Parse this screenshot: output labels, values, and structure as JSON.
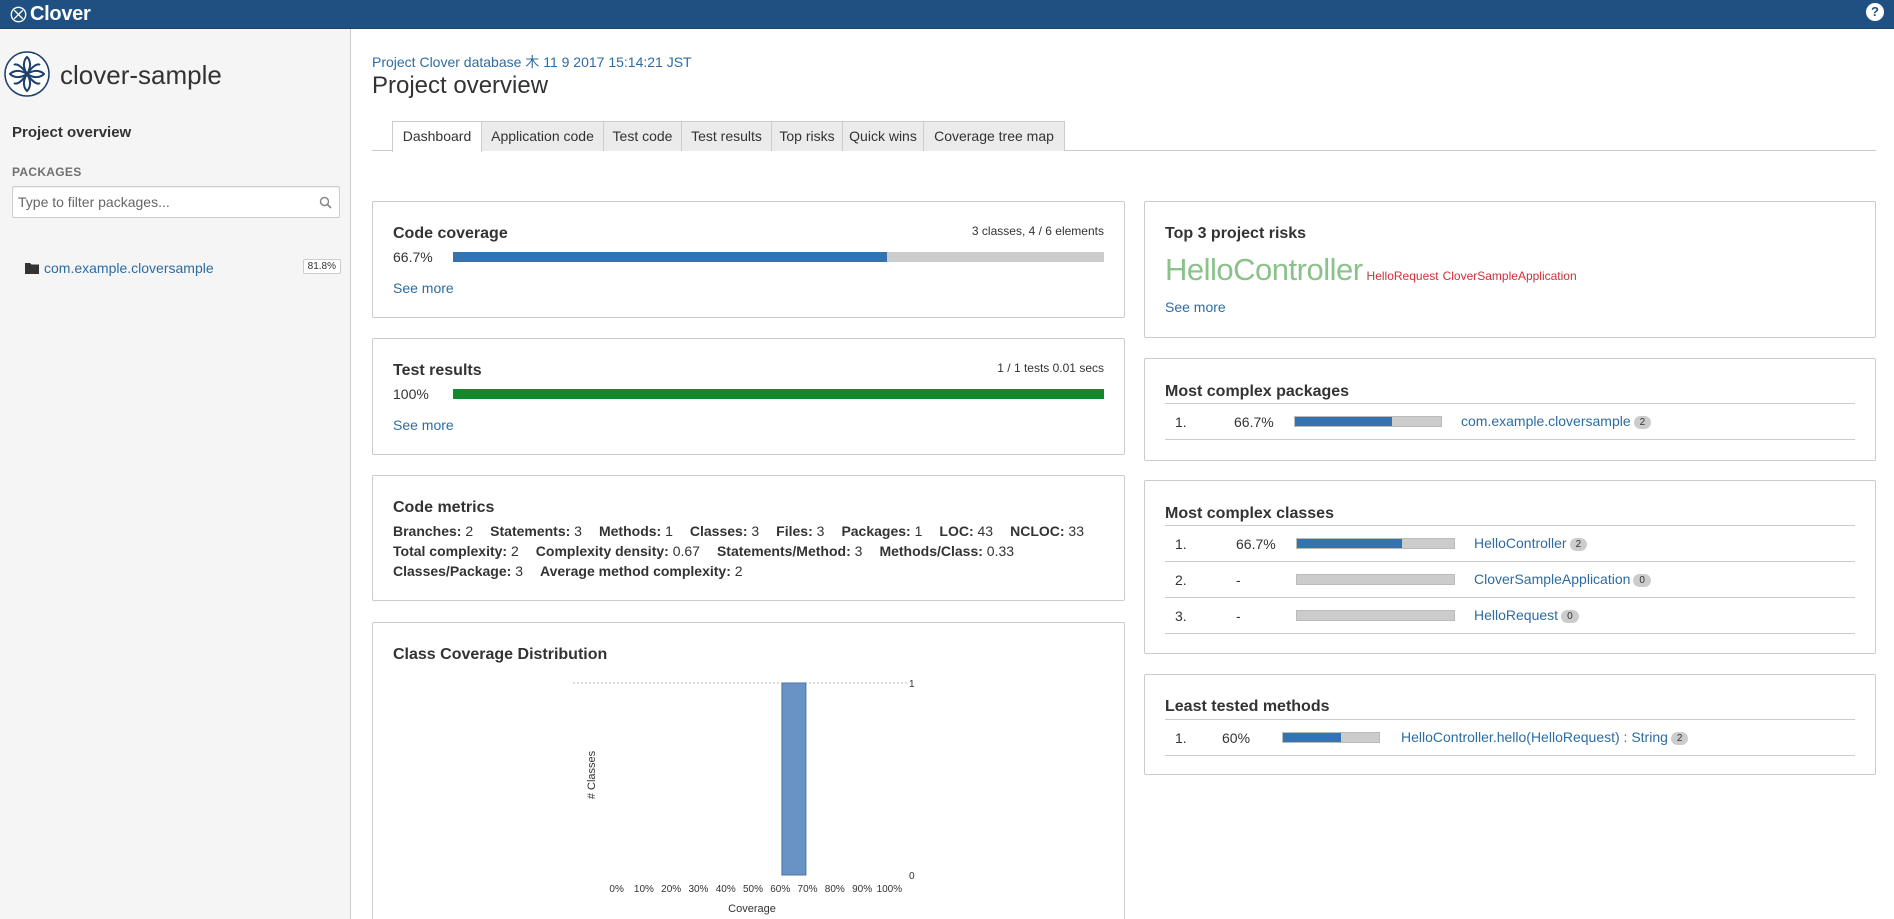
{
  "app": {
    "brand": "Clover",
    "help_glyph": "?"
  },
  "sidebar": {
    "project_name": "clover-sample",
    "nav_overview": "Project overview",
    "packages_header": "PACKAGES",
    "filter_placeholder": "Type to filter packages...",
    "packages": [
      {
        "name": "com.example.cloversample",
        "coverage": "81.8%"
      }
    ]
  },
  "header": {
    "database_line": "Project Clover database 木 11 9 2017 15:14:21 JST",
    "title": "Project overview"
  },
  "tabs": [
    {
      "label": "Dashboard",
      "active": true
    },
    {
      "label": "Application code"
    },
    {
      "label": "Test code"
    },
    {
      "label": "Test results"
    },
    {
      "label": "Top risks"
    },
    {
      "label": "Quick wins"
    },
    {
      "label": "Coverage tree map"
    }
  ],
  "code_coverage": {
    "title": "Code coverage",
    "summary": "3 classes, 4 / 6 elements",
    "percent_label": "66.7%",
    "percent": 0.667,
    "see_more": "See more"
  },
  "test_results": {
    "title": "Test results",
    "summary": "1 / 1 tests 0.01 secs",
    "percent_label": "100%",
    "percent": 1.0,
    "see_more": "See more"
  },
  "code_metrics": {
    "title": "Code metrics",
    "items": [
      {
        "k": "Branches:",
        "v": "2"
      },
      {
        "k": "Statements:",
        "v": "3"
      },
      {
        "k": "Methods:",
        "v": "1"
      },
      {
        "k": "Classes:",
        "v": "3"
      },
      {
        "k": "Files:",
        "v": "3"
      },
      {
        "k": "Packages:",
        "v": "1"
      },
      {
        "k": "LOC:",
        "v": "43"
      },
      {
        "k": "NCLOC:",
        "v": "33"
      },
      {
        "k": "Total complexity:",
        "v": "2"
      },
      {
        "k": "Complexity density:",
        "v": "0.67"
      },
      {
        "k": "Statements/Method:",
        "v": "3"
      },
      {
        "k": "Methods/Class:",
        "v": "0.33"
      },
      {
        "k": "Classes/Package:",
        "v": "3"
      },
      {
        "k": "Average method complexity:",
        "v": "2"
      }
    ]
  },
  "distribution": {
    "title": "Class Coverage Distribution"
  },
  "chart_data": {
    "type": "bar",
    "categories": [
      "0%",
      "10%",
      "20%",
      "30%",
      "40%",
      "50%",
      "60%",
      "70%",
      "80%",
      "90%",
      "100%"
    ],
    "values": [
      0,
      0,
      0,
      0,
      0,
      0,
      1,
      0,
      0,
      0,
      0
    ],
    "xlabel": "Coverage",
    "ylabel": "# Classes",
    "ylim": [
      0,
      1
    ],
    "y_ticks": [
      "1",
      "0"
    ],
    "bar_color": "#6893c4"
  },
  "top_risks": {
    "title": "Top 3 project risks",
    "primary": "HelloController",
    "secondary": [
      "HelloRequest",
      "CloverSampleApplication"
    ],
    "see_more": "See more"
  },
  "complex_packages": {
    "title": "Most complex packages",
    "rows": [
      {
        "rank": "1.",
        "pct": "66.7%",
        "coverage": 0.667,
        "name": "com.example.cloversample",
        "count": "2"
      }
    ]
  },
  "complex_classes": {
    "title": "Most complex classes",
    "rows": [
      {
        "rank": "1.",
        "pct": "66.7%",
        "coverage": 0.667,
        "name": "HelloController",
        "count": "2"
      },
      {
        "rank": "2.",
        "pct": "-",
        "coverage": 0,
        "name": "CloverSampleApplication",
        "count": "0"
      },
      {
        "rank": "3.",
        "pct": "-",
        "coverage": 0,
        "name": "HelloRequest",
        "count": "0"
      }
    ]
  },
  "least_tested": {
    "title": "Least tested methods",
    "rows": [
      {
        "rank": "1.",
        "pct": "60%",
        "coverage": 0.6,
        "name": "HelloController.hello(HelloRequest) : String",
        "count": "2"
      }
    ]
  },
  "colors": {
    "brand": "#205081",
    "coverage_bar": "#3572b0",
    "test_bar": "#14892c",
    "risk_primary": "#8bc28b",
    "risk_secondary": "#d0303a",
    "link": "#2d6ca2"
  }
}
